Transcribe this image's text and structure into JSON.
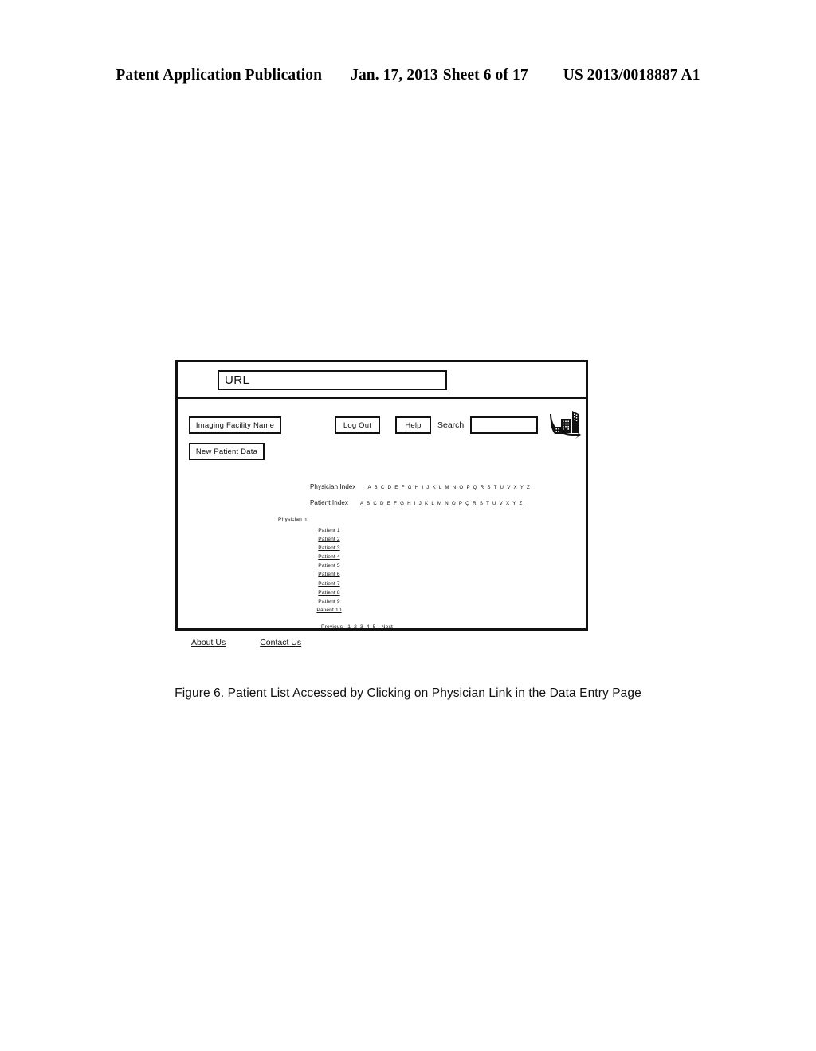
{
  "patent_header": {
    "title": "Patent Application Publication",
    "date": "Jan. 17, 2013",
    "sheet": "Sheet 6 of 17",
    "publication_number": "US 2013/0018887 A1"
  },
  "browser": {
    "url_value": "URL"
  },
  "toolbar": {
    "facility_button": "Imaging Facility Name",
    "new_patient_button": "New Patient Data",
    "logout_button": "Log Out",
    "help_button": "Help",
    "search_label": "Search",
    "search_value": "",
    "logo_name": "imaging-facility-logo"
  },
  "indexes": {
    "physician_label": "Physician Index",
    "physician_alphabet": "A B C D E F G H I J K L M N O P Q R S T U V X Y Z",
    "patient_label": "Patient Index",
    "patient_alphabet": "A B C D E F G H I J K L M N O P Q R S T U V X Y Z"
  },
  "physician_heading": "Physician n",
  "patients": [
    "Patient 1",
    "Patient 2",
    "Patient 3",
    "Patient 4",
    "Patient 5",
    "Patient 6",
    "Patient 7",
    "Patient 8",
    "Patient 9",
    "Patient 10"
  ],
  "pagination": {
    "previous": "Previous",
    "pages": [
      "1",
      "2",
      "3",
      "4",
      "5"
    ],
    "next": "Next"
  },
  "footer": {
    "about_us": "About Us",
    "contact_us": "Contact Us"
  },
  "caption": "Figure 6.  Patient List Accessed by Clicking on  Physician Link in the Data Entry Page",
  "colors": {
    "ink": "#111111",
    "page_background": "#ffffff"
  }
}
